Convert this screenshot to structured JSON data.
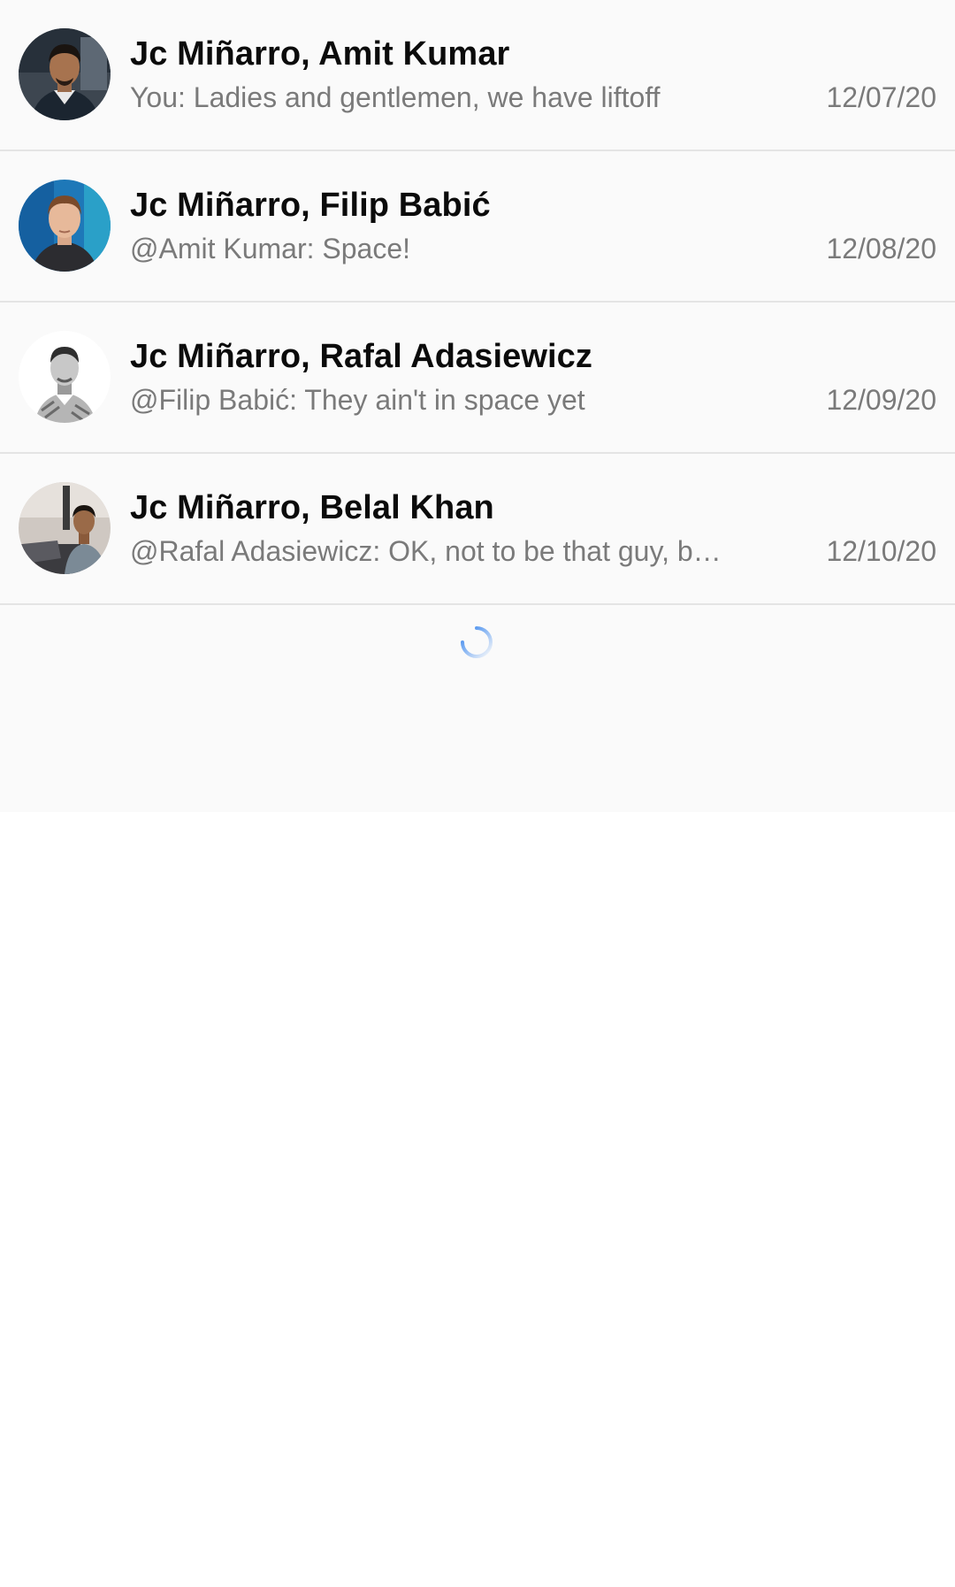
{
  "channels": [
    {
      "title": "Jc Miñarro, Amit Kumar",
      "preview": "You: Ladies and gentlemen, we have liftoff",
      "date": "12/07/20",
      "avatar_icon": "person-photo-icon"
    },
    {
      "title": "Jc Miñarro, Filip Babić",
      "preview": "@Amit Kumar: Space!",
      "date": "12/08/20",
      "avatar_icon": "person-photo-icon"
    },
    {
      "title": "Jc Miñarro, Rafal Adasiewicz",
      "preview": "@Filip Babić: They ain't in space yet",
      "date": "12/09/20",
      "avatar_icon": "person-photo-icon"
    },
    {
      "title": "Jc Miñarro, Belal Khan",
      "preview": "@Rafal Adasiewicz: OK, not to be that guy, b…",
      "date": "12/10/20",
      "avatar_icon": "person-photo-icon"
    }
  ],
  "loading": {
    "indicator": "spinner-icon",
    "color": "#2f80ed"
  },
  "colors": {
    "background": "#fafafa",
    "title": "#0b0b0b",
    "secondary_text": "#7a7a7a",
    "divider": "#e4e4e4"
  }
}
